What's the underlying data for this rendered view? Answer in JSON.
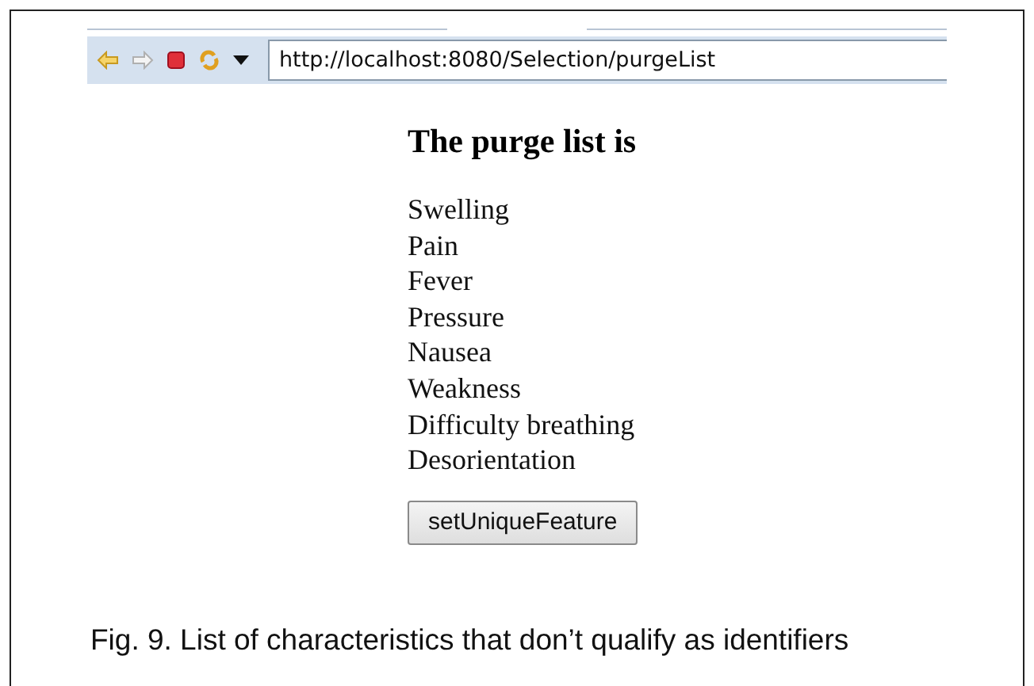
{
  "browser": {
    "url": "http://localhost:8080/Selection/purgeList",
    "back_disabled": false,
    "forward_disabled": true
  },
  "page": {
    "heading": "The purge list is",
    "items": [
      "Swelling",
      "Pain",
      "Fever",
      "Pressure",
      "Nausea",
      "Weakness",
      "Difficulty breathing",
      "Desorientation"
    ],
    "button": "setUniqueFeature"
  },
  "caption": "Fig. 9. List of characteristics that don’t qualify as identifiers"
}
